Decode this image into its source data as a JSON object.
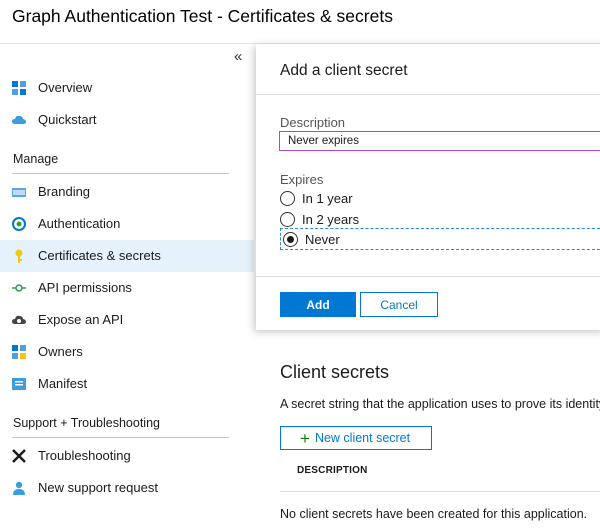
{
  "header": {
    "title": "Graph Authentication Test - Certificates & secrets"
  },
  "sidebar": {
    "collapse_glyph": "«",
    "items_top": [
      {
        "label": "Overview",
        "icon": "overview-grid-icon"
      },
      {
        "label": "Quickstart",
        "icon": "cloud-icon"
      }
    ],
    "manage_heading": "Manage",
    "manage_items": [
      {
        "label": "Branding",
        "icon": "branding-icon"
      },
      {
        "label": "Authentication",
        "icon": "authentication-icon"
      },
      {
        "label": "Certificates & secrets",
        "icon": "key-icon",
        "active": true
      },
      {
        "label": "API permissions",
        "icon": "api-permissions-icon"
      },
      {
        "label": "Expose an API",
        "icon": "cloud-gear-icon"
      },
      {
        "label": "Owners",
        "icon": "owners-icon"
      },
      {
        "label": "Manifest",
        "icon": "manifest-icon"
      }
    ],
    "support_heading": "Support + Troubleshooting",
    "support_items": [
      {
        "label": "Troubleshooting",
        "icon": "tools-icon"
      },
      {
        "label": "New support request",
        "icon": "support-person-icon"
      }
    ]
  },
  "panel": {
    "title": "Add a client secret",
    "description_label": "Description",
    "description_value": "Never expires",
    "expires_label": "Expires",
    "options": [
      {
        "label": "In 1 year",
        "selected": false
      },
      {
        "label": "In 2 years",
        "selected": false
      },
      {
        "label": "Never",
        "selected": true
      }
    ],
    "add_label": "Add",
    "cancel_label": "Cancel"
  },
  "client_secrets": {
    "title": "Client secrets",
    "text": "A secret string that the application uses to prove its identity when requesting a token.",
    "new_button": "New client secret",
    "column_description": "DESCRIPTION",
    "empty_message": "No client secrets have been created for this application."
  },
  "colors": {
    "accent": "#0078d4",
    "active_bg": "#e5f1fb",
    "input_border": "#b146c2",
    "plus": "#107c10"
  }
}
